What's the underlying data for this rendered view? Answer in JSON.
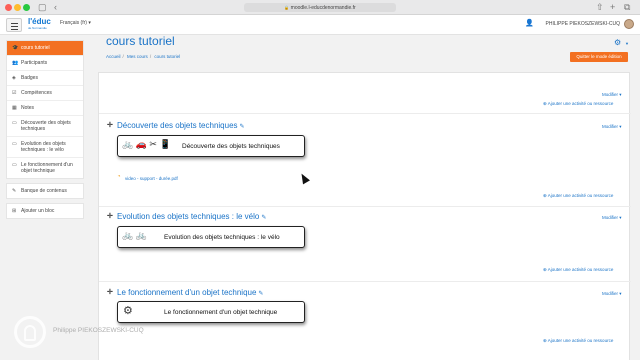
{
  "browser": {
    "url": "moodle.l-educdenormandie.fr"
  },
  "navbar": {
    "menu_icon": "hamburger-icon",
    "logo_main": "l'éduc",
    "logo_sub": "de Normandie",
    "language": "Français (fr) ▾",
    "user_name": "PHILIPPE PIEKOSZEWSKI-CUQ"
  },
  "sidebar": {
    "nav": [
      {
        "label": "cours tutoriel",
        "icon": "graduation-cap-icon",
        "glyph": "🎓"
      },
      {
        "label": "Participants",
        "icon": "users-icon",
        "glyph": "👥"
      },
      {
        "label": "Badges",
        "icon": "badge-icon",
        "glyph": "◈"
      },
      {
        "label": "Compétences",
        "icon": "check-square-icon",
        "glyph": "☑"
      },
      {
        "label": "Notes",
        "icon": "table-icon",
        "glyph": "▦"
      },
      {
        "label": "Découverte des objets techniques",
        "icon": "folder-icon",
        "glyph": "▭"
      },
      {
        "label": "Evolution des objets techniques : le vélo",
        "icon": "folder-icon",
        "glyph": "▭"
      },
      {
        "label": "Le fonctionnement d'un objet technique",
        "icon": "folder-icon",
        "glyph": "▭"
      }
    ],
    "tools": [
      {
        "label": "Banque de contenus",
        "icon": "paint-brush-icon",
        "glyph": "✎"
      }
    ],
    "extra": [
      {
        "label": "Ajouter un bloc",
        "icon": "plus-square-icon",
        "glyph": "⊞"
      }
    ]
  },
  "header": {
    "title": "cours tutoriel",
    "breadcrumb": [
      "Accueil",
      "Mes cours",
      "cours tutoriel"
    ],
    "quit_edit": "Quitter le mode édition"
  },
  "course": {
    "top": {
      "modify": "Modifier ▾",
      "add_activity": "Ajouter une activité ou ressource"
    },
    "sections": [
      {
        "title": "Découverte des objets techniques",
        "modify": "Modifier ▾",
        "banner_text": "Découverte des objets techniques",
        "banner_icons": "🚲 🚗 ✂ 📱",
        "file": "video - support - durée.pdf",
        "add_activity": "Ajouter une activité ou ressource"
      },
      {
        "title": "Evolution des objets techniques : le vélo",
        "modify": "Modifier ▾",
        "banner_text": "Evolution des objets techniques : le vélo",
        "banner_icons": "🚲 🚲",
        "add_activity": "Ajouter une activité ou ressource"
      },
      {
        "title": "Le fonctionnement d'un objet technique",
        "modify": "Modifier ▾",
        "banner_text": "Le fonctionnement d'un objet technique",
        "banner_icons": "⚙",
        "add_activity": "Ajouter une activité ou ressource"
      }
    ]
  },
  "watermark": {
    "name": "Philippe PIEKOSZEWSKI-CUQ"
  },
  "colors": {
    "accent": "#f37021",
    "link": "#1a73c7"
  }
}
